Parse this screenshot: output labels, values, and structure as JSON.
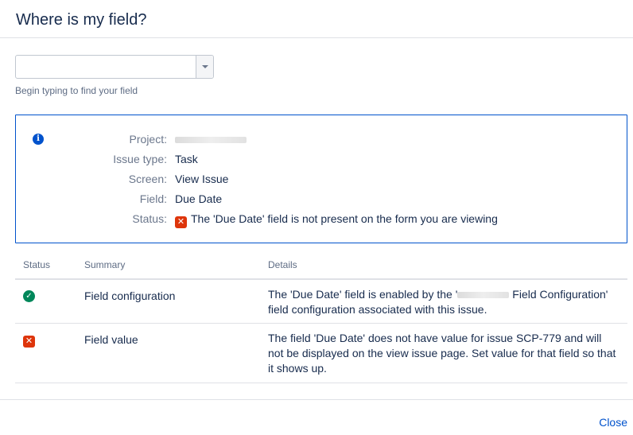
{
  "dialog": {
    "title": "Where is my field?"
  },
  "picker": {
    "value": "",
    "hint": "Begin typing to find your field"
  },
  "info": {
    "icon": "info-icon",
    "rows": [
      {
        "label": "Project:",
        "value": ""
      },
      {
        "label": "Issue type:",
        "value": "Task"
      },
      {
        "label": "Screen:",
        "value": "View Issue"
      },
      {
        "label": "Field:",
        "value": "Due Date"
      },
      {
        "label": "Status:",
        "value": "The 'Due Date' field is not present on the form you are viewing"
      }
    ]
  },
  "results": {
    "headers": {
      "status": "Status",
      "summary": "Summary",
      "details": "Details"
    },
    "rows": [
      {
        "status_icon": "success-check-icon",
        "summary": "Field configuration",
        "details_part1": "The 'Due Date' field is enabled by the '",
        "details_part2": "Field Configuration' field configuration associated with this issue."
      },
      {
        "status_icon": "error-cross-icon",
        "summary": "Field value",
        "details": "The field 'Due Date' does not have value for issue SCP-779 and will not be displayed on the view issue page. Set value for that field so that it shows up."
      }
    ]
  },
  "footer": {
    "close_label": "Close"
  },
  "colors": {
    "accent": "#0052cc",
    "error": "#de350b",
    "success": "#00875a"
  }
}
